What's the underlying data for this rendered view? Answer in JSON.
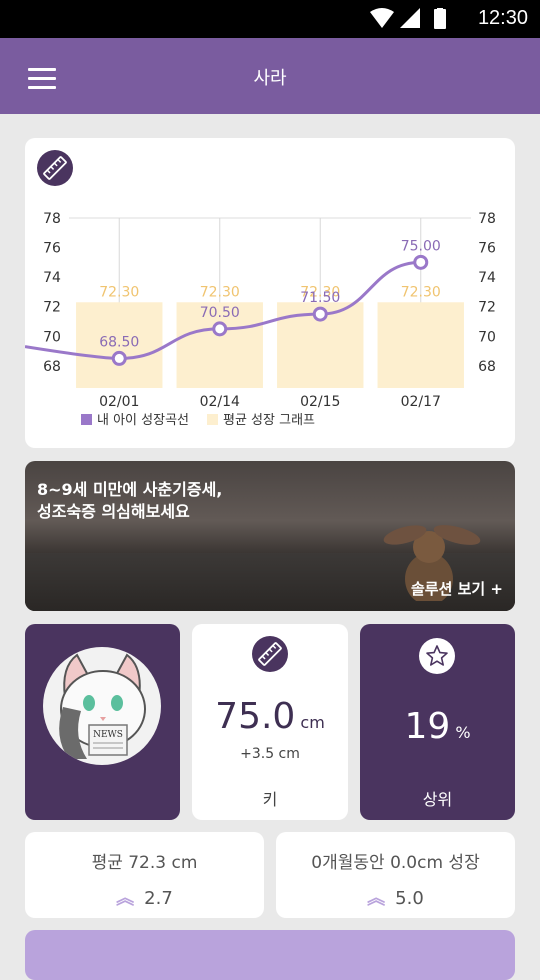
{
  "status_bar": {
    "time": "12:30"
  },
  "app_bar": {
    "title": "사라"
  },
  "chart_data": {
    "type": "line",
    "categories": [
      "02/01",
      "02/14",
      "02/15",
      "02/17"
    ],
    "series": [
      {
        "name": "내 아이 성장곡선",
        "type": "line",
        "values": [
          68.5,
          70.5,
          71.5,
          75.0
        ],
        "labels": [
          "68.50",
          "70.50",
          "71.50",
          "75.00"
        ],
        "color": "#9a78c9"
      },
      {
        "name": "평균 성장 그래프",
        "type": "bar",
        "values": [
          72.3,
          72.3,
          72.3,
          72.3
        ],
        "labels": [
          "72.30",
          "72.30",
          "72.30",
          "72.30"
        ],
        "color": "#fdefcf"
      }
    ],
    "y_ticks": [
      "78",
      "76",
      "74",
      "72",
      "70",
      "68"
    ],
    "ylim": [
      66.5,
      78
    ],
    "grid": "vertical"
  },
  "banner": {
    "line1": "8~9세 미만에 사춘기증세,",
    "line2": "성조숙증 의심해보세요",
    "cta": "솔루션 보기 +"
  },
  "height_tile": {
    "value": "75.0",
    "unit": "cm",
    "delta": "+3.5 cm",
    "label": "키"
  },
  "rank_tile": {
    "value": "19",
    "unit": "%",
    "label": "상위"
  },
  "avg_card": {
    "label": "평균 72.3 cm",
    "value": "2.7"
  },
  "growth_card": {
    "label": "0개월동안 0.0cm 성장",
    "value": "5.0"
  },
  "colors": {
    "primary": "#7a5c9f",
    "dark_purple": "#4a345f",
    "light_purple": "#b9a3dc",
    "bar": "#fdefcf",
    "bar_label": "#f0c470"
  }
}
